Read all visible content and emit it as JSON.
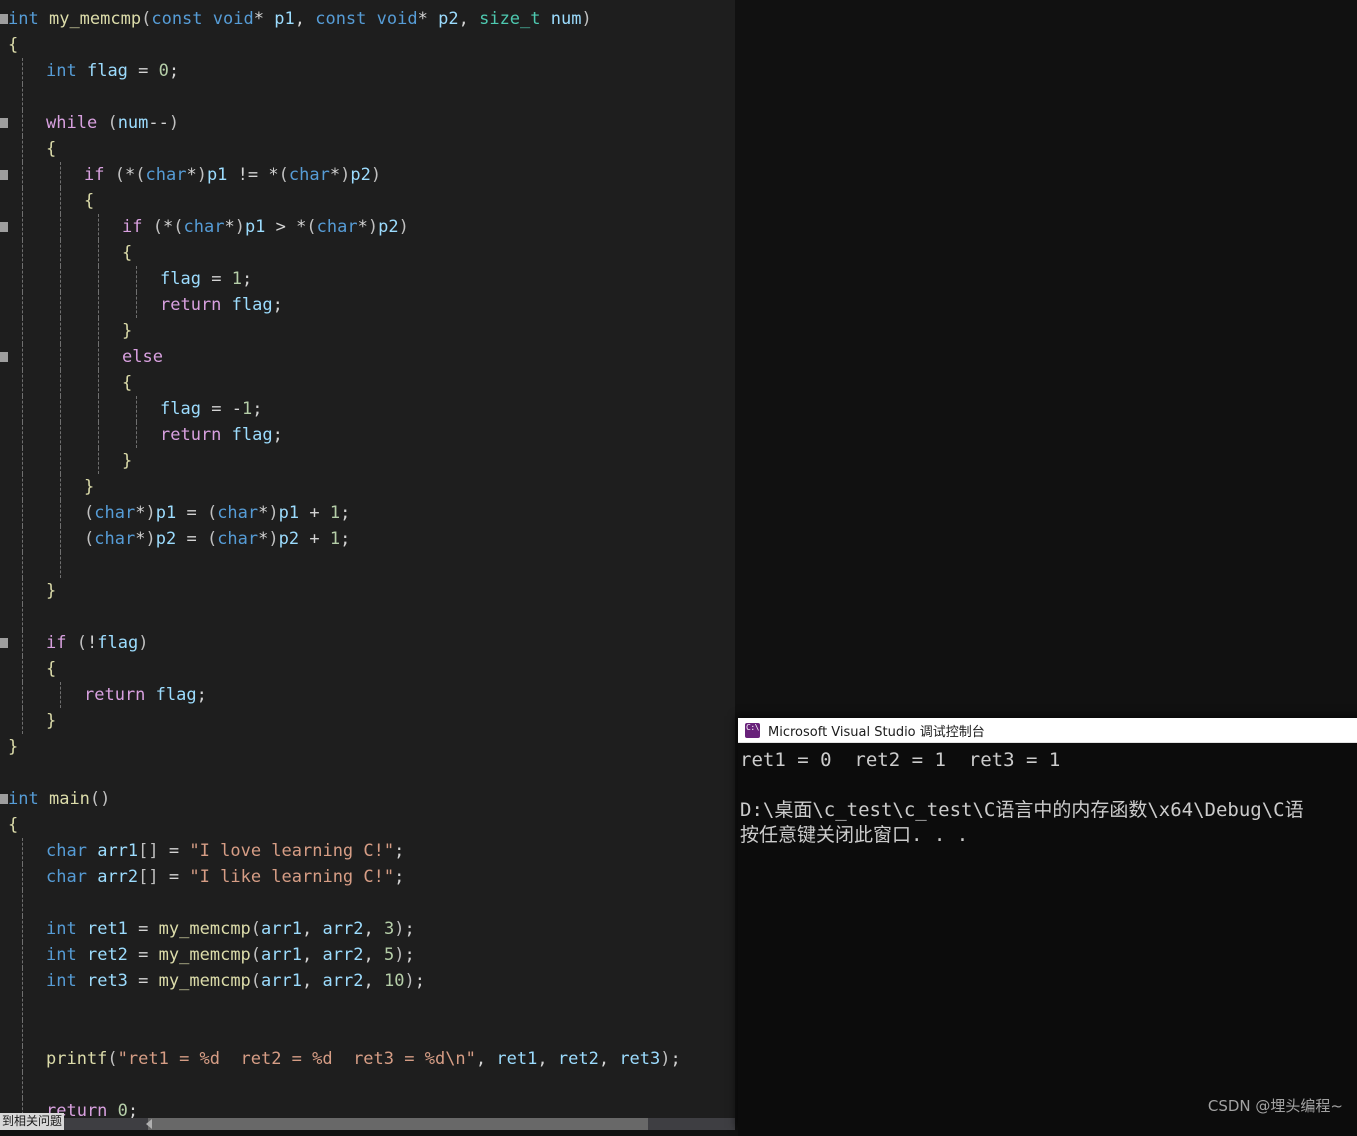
{
  "editor": {
    "language": "c",
    "background_color": "#1E1E1E",
    "lines": [
      {
        "indent": 0,
        "collapse": true,
        "guides": 0,
        "text": "int my_memcmp(const void* p1, const void* p2, size_t num)"
      },
      {
        "indent": 0,
        "collapse": false,
        "guides": 0,
        "text": "{"
      },
      {
        "indent": 1,
        "collapse": false,
        "guides": 1,
        "text": "int flag = 0;"
      },
      {
        "indent": 1,
        "collapse": false,
        "guides": 1,
        "text": ""
      },
      {
        "indent": 1,
        "collapse": true,
        "guides": 1,
        "text": "while (num--)"
      },
      {
        "indent": 1,
        "collapse": false,
        "guides": 1,
        "text": "{"
      },
      {
        "indent": 2,
        "collapse": true,
        "guides": 2,
        "text": "if (*(char*)p1 != *(char*)p2)"
      },
      {
        "indent": 2,
        "collapse": false,
        "guides": 2,
        "text": "{"
      },
      {
        "indent": 3,
        "collapse": true,
        "guides": 3,
        "text": "if (*(char*)p1 > *(char*)p2)"
      },
      {
        "indent": 3,
        "collapse": false,
        "guides": 3,
        "text": "{"
      },
      {
        "indent": 4,
        "collapse": false,
        "guides": 4,
        "text": "flag = 1;"
      },
      {
        "indent": 4,
        "collapse": false,
        "guides": 4,
        "text": "return flag;"
      },
      {
        "indent": 3,
        "collapse": false,
        "guides": 3,
        "text": "}"
      },
      {
        "indent": 3,
        "collapse": true,
        "guides": 3,
        "text": "else"
      },
      {
        "indent": 3,
        "collapse": false,
        "guides": 3,
        "text": "{"
      },
      {
        "indent": 4,
        "collapse": false,
        "guides": 4,
        "text": "flag = -1;"
      },
      {
        "indent": 4,
        "collapse": false,
        "guides": 4,
        "text": "return flag;"
      },
      {
        "indent": 3,
        "collapse": false,
        "guides": 3,
        "text": "}"
      },
      {
        "indent": 2,
        "collapse": false,
        "guides": 2,
        "text": "}"
      },
      {
        "indent": 2,
        "collapse": false,
        "guides": 2,
        "text": "(char*)p1 = (char*)p1 + 1;"
      },
      {
        "indent": 2,
        "collapse": false,
        "guides": 2,
        "text": "(char*)p2 = (char*)p2 + 1;"
      },
      {
        "indent": 2,
        "collapse": false,
        "guides": 2,
        "text": ""
      },
      {
        "indent": 1,
        "collapse": false,
        "guides": 1,
        "text": "}"
      },
      {
        "indent": 1,
        "collapse": false,
        "guides": 1,
        "text": ""
      },
      {
        "indent": 1,
        "collapse": true,
        "guides": 1,
        "text": "if (!flag)"
      },
      {
        "indent": 1,
        "collapse": false,
        "guides": 1,
        "text": "{"
      },
      {
        "indent": 2,
        "collapse": false,
        "guides": 2,
        "text": "return flag;"
      },
      {
        "indent": 1,
        "collapse": false,
        "guides": 1,
        "text": "}"
      },
      {
        "indent": 0,
        "collapse": false,
        "guides": 0,
        "text": "}"
      },
      {
        "indent": 0,
        "collapse": false,
        "guides": 0,
        "text": ""
      },
      {
        "indent": 0,
        "collapse": true,
        "guides": 0,
        "text": "int main()"
      },
      {
        "indent": 0,
        "collapse": false,
        "guides": 0,
        "text": "{"
      },
      {
        "indent": 1,
        "collapse": false,
        "guides": 1,
        "text": "char arr1[] = \"I love learning C!\";"
      },
      {
        "indent": 1,
        "collapse": false,
        "guides": 1,
        "text": "char arr2[] = \"I like learning C!\";"
      },
      {
        "indent": 1,
        "collapse": false,
        "guides": 1,
        "text": ""
      },
      {
        "indent": 1,
        "collapse": false,
        "guides": 1,
        "text": "int ret1 = my_memcmp(arr1, arr2, 3);"
      },
      {
        "indent": 1,
        "collapse": false,
        "guides": 1,
        "text": "int ret2 = my_memcmp(arr1, arr2, 5);"
      },
      {
        "indent": 1,
        "collapse": false,
        "guides": 1,
        "text": "int ret3 = my_memcmp(arr1, arr2, 10);"
      },
      {
        "indent": 1,
        "collapse": false,
        "guides": 1,
        "text": ""
      },
      {
        "indent": 1,
        "collapse": false,
        "guides": 1,
        "text": ""
      },
      {
        "indent": 1,
        "collapse": false,
        "guides": 1,
        "text": "printf(\"ret1 = %d  ret2 = %d  ret3 = %d\\n\", ret1, ret2, ret3);"
      },
      {
        "indent": 1,
        "collapse": false,
        "guides": 1,
        "text": ""
      },
      {
        "indent": 1,
        "collapse": false,
        "guides": 1,
        "text": "return 0;"
      }
    ]
  },
  "status_strip": {
    "text": "到相关问题"
  },
  "scrollbar": {
    "orientation": "horizontal",
    "left_arrow_icon": "triangle-left-icon"
  },
  "console": {
    "icon": "visual-studio-console-icon",
    "title": "Microsoft Visual Studio 调试控制台",
    "background_color": "#0C0C0C",
    "text_color": "#CCCCCC",
    "lines": [
      "ret1 = 0  ret2 = 1  ret3 = 1",
      "",
      "D:\\桌面\\c_test\\c_test\\C语言中的内存函数\\x64\\Debug\\C语",
      "按任意键关闭此窗口. . ."
    ]
  },
  "watermark": {
    "text": "CSDN @埋头编程~"
  }
}
